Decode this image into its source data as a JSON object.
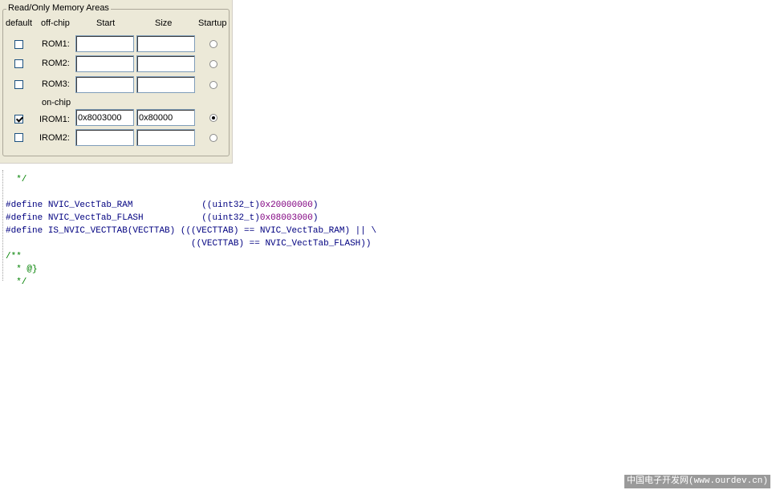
{
  "dialog": {
    "group_title": "Read/Only Memory Areas",
    "headers": {
      "default": "default",
      "offchip": "off-chip",
      "start": "Start",
      "size": "Size",
      "startup": "Startup"
    },
    "onchip_label": "on-chip",
    "rows": [
      {
        "label": "ROM1:",
        "default_checked": false,
        "start": "",
        "size": "",
        "startup_selected": false
      },
      {
        "label": "ROM2:",
        "default_checked": false,
        "start": "",
        "size": "",
        "startup_selected": false
      },
      {
        "label": "ROM3:",
        "default_checked": false,
        "start": "",
        "size": "",
        "startup_selected": false
      },
      {
        "label": "IROM1:",
        "default_checked": true,
        "start": "0x8003000",
        "size": "0x80000",
        "startup_selected": true
      },
      {
        "label": "IROM2:",
        "default_checked": false,
        "start": "",
        "size": "",
        "startup_selected": false
      }
    ]
  },
  "code": {
    "line1": "  */",
    "line2": "",
    "line3_kw": "#define",
    "line3_name": " NVIC_VectTab_RAM             ((uint32_t)",
    "line3_val": "0x20000000",
    "line3_end": ")",
    "line4_kw": "#define",
    "line4_name": " NVIC_VectTab_FLASH           ((uint32_t)",
    "line4_val": "0x08003000",
    "line4_end": ")",
    "line5_kw": "#define",
    "line5_rest": " IS_NVIC_VECTTAB(VECTTAB) (((VECTTAB) == NVIC_VectTab_RAM) || \\",
    "line6": "                                   ((VECTTAB) == NVIC_VectTab_FLASH))",
    "line7": "/**",
    "line8": "  * @}",
    "line9": "  */"
  },
  "watermark": "中国电子开发网(www.ourdev.cn)"
}
